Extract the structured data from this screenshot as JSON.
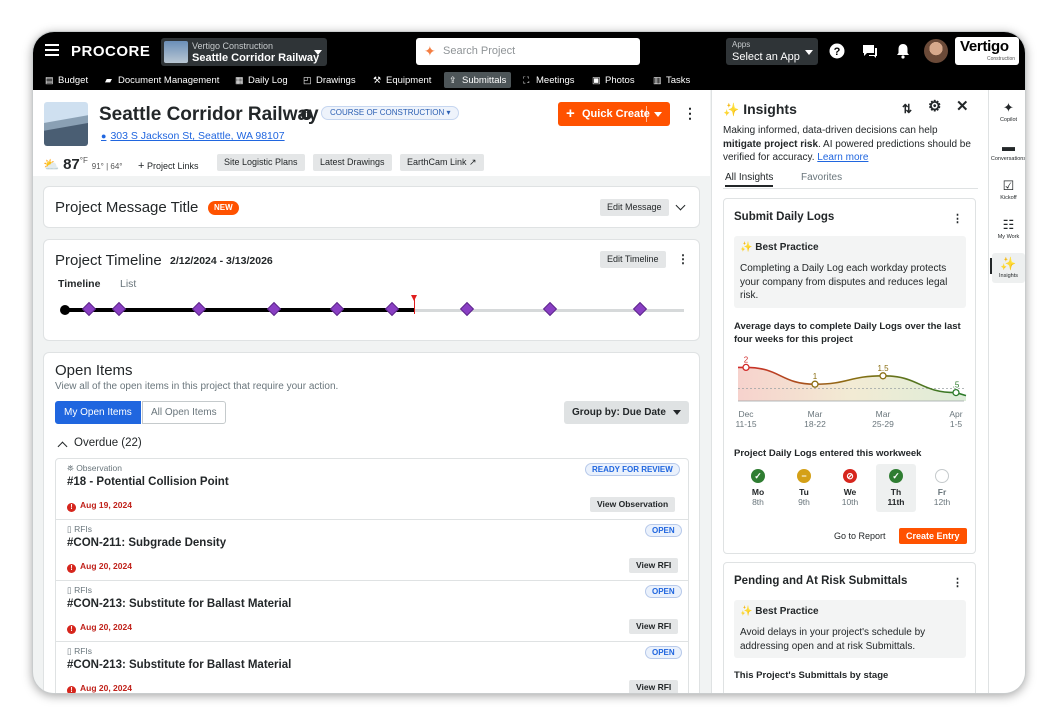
{
  "topbar": {
    "logo": "PROCORE",
    "company": "Vertigo Construction",
    "project": "Seattle Corridor Railway",
    "search_placeholder": "Search Project",
    "apps_label": "Apps",
    "apps_value": "Select an App",
    "brand": "Vertigo",
    "brand_sub": "Construction"
  },
  "nav": [
    {
      "label": "Budget",
      "icon": "budget-icon"
    },
    {
      "label": "Document Management",
      "icon": "folder-icon"
    },
    {
      "label": "Daily Log",
      "icon": "daily-log-icon"
    },
    {
      "label": "Drawings",
      "icon": "drawings-icon"
    },
    {
      "label": "Equipment",
      "icon": "equipment-icon"
    },
    {
      "label": "Submittals",
      "icon": "submittals-icon",
      "active": true
    },
    {
      "label": "Meetings",
      "icon": "meetings-icon"
    },
    {
      "label": "Photos",
      "icon": "photos-icon"
    },
    {
      "label": "Tasks",
      "icon": "tasks-icon"
    }
  ],
  "header": {
    "title": "Seattle Corridor Railway",
    "stage": "COURSE OF CONSTRUCTION",
    "address": "303 S Jackson St, Seattle, WA 98107",
    "quick_create": "Quick Create",
    "temp": "87",
    "temp_unit": "°F",
    "temp_range": "91° | 64°",
    "project_links": "Project Links",
    "chips": [
      "Site Logistic Plans",
      "Latest Drawings",
      "EarthCam Link"
    ]
  },
  "message": {
    "title": "Project Message Title",
    "badge": "NEW",
    "edit": "Edit Message"
  },
  "timeline": {
    "title": "Project Timeline",
    "dates": "2/12/2024 - 3/13/2026",
    "edit": "Edit Timeline",
    "tabs": [
      "Timeline",
      "List"
    ]
  },
  "open_items": {
    "title": "Open Items",
    "subtitle": "View all of the open items in this project that require your action.",
    "seg_on": "My Open Items",
    "seg_off": "All Open Items",
    "group_by": "Group by: Due Date",
    "overdue": "Overdue (22)",
    "items": [
      {
        "type": "Observation",
        "title": "#18 - Potential Collision Point",
        "date": "Aug 19, 2024",
        "status": "READY FOR REVIEW",
        "action": "View Observation"
      },
      {
        "type": "RFIs",
        "title": "#CON-211: Subgrade Density",
        "date": "Aug 20, 2024",
        "status": "OPEN",
        "action": "View RFI"
      },
      {
        "type": "RFIs",
        "title": "#CON-213: Substitute for Ballast Material",
        "date": "Aug 20, 2024",
        "status": "OPEN",
        "action": "View RFI"
      },
      {
        "type": "RFIs",
        "title": "#CON-213: Substitute for Ballast Material",
        "date": "Aug 20, 2024",
        "status": "OPEN",
        "action": "View RFI"
      }
    ]
  },
  "insights": {
    "title": "Insights",
    "desc_1": "Making informed, data-driven decisions can help ",
    "desc_bold": "mitigate project risk",
    "desc_2": ". AI powered predictions should be verified for accuracy. ",
    "learn_more": "Learn more",
    "tabs": [
      "All Insights",
      "Favorites"
    ],
    "card1": {
      "title": "Submit Daily Logs",
      "bp_head": "Best Practice",
      "bp_text": "Completing a Daily Log each workday protects your company from disputes and reduces legal risk.",
      "chart_title": "Average days to complete Daily Logs over the last four weeks for this project",
      "week_title": "Project Daily Logs entered this workweek",
      "days": [
        {
          "name": "Mo",
          "num": "8th",
          "state": "done"
        },
        {
          "name": "Tu",
          "num": "9th",
          "state": "partial"
        },
        {
          "name": "We",
          "num": "10th",
          "state": "missed"
        },
        {
          "name": "Th",
          "num": "11th",
          "state": "done"
        },
        {
          "name": "Fr",
          "num": "12th",
          "state": "future"
        }
      ],
      "go_report": "Go to Report",
      "create_entry": "Create Entry"
    },
    "card2": {
      "title": "Pending and At Risk Submittals",
      "bp_head": "Best Practice",
      "bp_text": "Avoid delays in your project's schedule by addressing open and at risk Submittals.",
      "stage_title": "This Project's Submittals by stage"
    }
  },
  "chart_data": {
    "type": "line",
    "title": "Average days to complete Daily Logs over the last four weeks for this project",
    "categories": [
      "Dec 11-15",
      "Mar 18-22",
      "Mar 25-29",
      "Apr 1-5"
    ],
    "x": [
      "Dec\n11-15",
      "Mar\n18-22",
      "Mar\n25-29",
      "Apr\n1-5"
    ],
    "series": [
      {
        "values": [
          2,
          1,
          1.5,
          0.5
        ]
      }
    ],
    "labels": [
      "2",
      "1",
      "1.5",
      ".5"
    ],
    "ylim": [
      0,
      2.5
    ],
    "colors": {
      "high": "#d12a2a",
      "mid": "#8a6e12",
      "low": "#2a7a2a"
    }
  },
  "rail": [
    {
      "label": "Copilot",
      "icon": "copilot-icon"
    },
    {
      "label": "Conversations",
      "icon": "conversations-icon"
    },
    {
      "label": "Kickoff",
      "icon": "kickoff-icon"
    },
    {
      "label": "My Work",
      "icon": "my-work-icon"
    },
    {
      "label": "Insights",
      "icon": "insights-icon",
      "active": true
    }
  ]
}
